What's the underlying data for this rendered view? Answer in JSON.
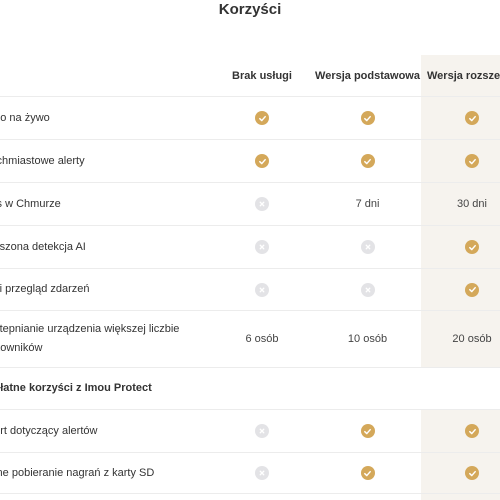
{
  "page": {
    "title": "Korzyści"
  },
  "table": {
    "headers": [
      "",
      "Brak usługi",
      "Wersja podstawowa",
      "Wersja rozszerz"
    ],
    "rows": [
      {
        "label": "deo na żywo",
        "cells": [
          {
            "icon": "check-icon"
          },
          {
            "icon": "check-icon"
          },
          {
            "icon": "check-icon"
          }
        ]
      },
      {
        "label": "tychmiastowe alerty",
        "cells": [
          {
            "icon": "check-icon"
          },
          {
            "icon": "check-icon"
          },
          {
            "icon": "check-icon"
          }
        ]
      },
      {
        "label": "ois w Chmurze",
        "cells": [
          {
            "icon": "cross-icon"
          },
          {
            "text": "7 dni"
          },
          {
            "text": "30 dni"
          }
        ]
      },
      {
        "label": "ększona detekcja AI",
        "cells": [
          {
            "icon": "cross-icon"
          },
          {
            "icon": "cross-icon"
          },
          {
            "icon": "check-icon"
          }
        ]
      },
      {
        "label": "bki przegląd zdarzeń",
        "cells": [
          {
            "icon": "cross-icon"
          },
          {
            "icon": "cross-icon"
          },
          {
            "icon": "check-icon"
          }
        ]
      },
      {
        "label_line1": "ostepnianie urządzenia większej liczbie",
        "label_line2": "rtkowników",
        "cells": [
          {
            "text": "6 osób"
          },
          {
            "text": "10 osób"
          },
          {
            "text": "20 osób"
          }
        ]
      }
    ],
    "section_title": "zpłatne korzyści z Imou Protect",
    "section_rows": [
      {
        "label": "port dotyczący alertów",
        "cells": [
          {
            "icon": "cross-icon"
          },
          {
            "icon": "check-icon"
          },
          {
            "icon": "check-icon"
          }
        ]
      },
      {
        "label": "alne pobieranie nagrań z karty SD",
        "cells": [
          {
            "icon": "cross-icon"
          },
          {
            "icon": "check-icon"
          },
          {
            "icon": "check-icon"
          }
        ]
      }
    ]
  },
  "colors": {
    "check": "#d4a85a",
    "cross": "#e3e3e6",
    "highlight_column": "#f6f3ee"
  }
}
